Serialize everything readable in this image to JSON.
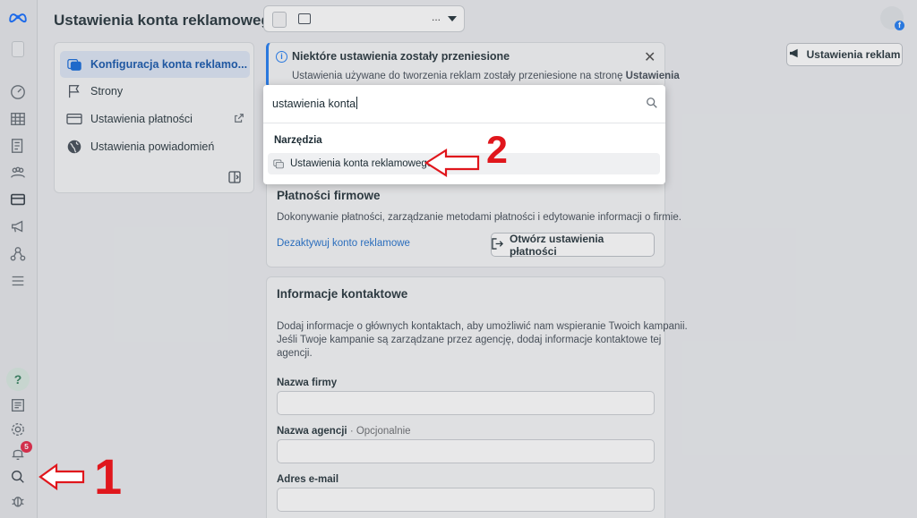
{
  "header": {
    "title": "Ustawienia konta reklamowego",
    "account_dots": "..."
  },
  "ad_settings_button": "Ustawienia reklam",
  "menu": [
    {
      "label": "Konfiguracja konta reklamo...",
      "icon": "ad-account-icon",
      "active": true
    },
    {
      "label": "Strony",
      "icon": "flag-icon"
    },
    {
      "label": "Ustawienia płatności",
      "icon": "credit-card-icon",
      "external": true
    },
    {
      "label": "Ustawienia powiadomień",
      "icon": "globe-icon"
    }
  ],
  "notice": {
    "title": "Niektóre ustawienia zostały przeniesione",
    "text": "Ustawienia używane do tworzenia reklam zostały przeniesione na stronę",
    "text_bold": "Ustawienia"
  },
  "payments": {
    "title": "Płatności firmowe",
    "desc": "Dokonywanie płatności, zarządzanie metodami płatności i edytowanie informacji o firmie.",
    "deactivate_link": "Dezaktywuj konto reklamowe",
    "open_button": "Otwórz ustawienia płatności"
  },
  "contact": {
    "title": "Informacje kontaktowe",
    "desc_1": "Dodaj informacje o głównych kontaktach, aby umożliwić nam wspieranie Twoich kampanii.",
    "desc_2": "Jeśli Twoje kampanie są zarządzane przez agencję, dodaj informacje kontaktowe tej",
    "desc_3": "agencji.",
    "company_label": "Nazwa firmy",
    "agency_label": "Nazwa agencji",
    "agency_optional": " · Opcjonalnie",
    "email_label": "Adres e-mail"
  },
  "search": {
    "query": "ustawienia konta",
    "section": "Narzędzia",
    "result": "Ustawienia konta reklamowego"
  },
  "notifications_badge": "5",
  "annotations": {
    "one": "1",
    "two": "2"
  },
  "colors": {
    "accent": "#0a64d9",
    "annotation": "#e0161c",
    "badge": "#e41e3f"
  }
}
